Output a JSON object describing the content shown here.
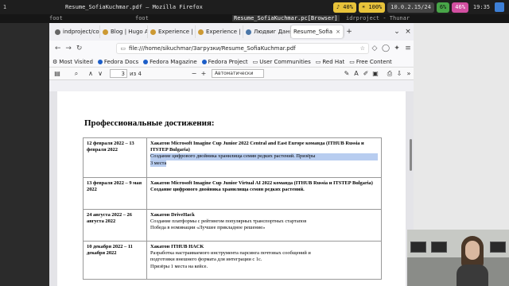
{
  "system_bar": {
    "workspace": "1",
    "window_title": "Resume_SofiaKuchmar.pdf — Mozilla Firefox",
    "volume": "40%",
    "brightness": "100%",
    "network": "10.0.2.15/24",
    "cpu": "6%",
    "battery": "46%",
    "clock": "19:35"
  },
  "taskbar": {
    "left_label": "foot",
    "mid_label": "foot",
    "active_label": "Resume_SofiaKuchmar.pc[Browser]",
    "right_label": "idrproject - Thunar"
  },
  "tabs": [
    {
      "label": "indproject/con",
      "active": false
    },
    {
      "label": "Blog | Hugo Ac",
      "active": false
    },
    {
      "label": "Experience | H",
      "active": false
    },
    {
      "label": "Experience | H",
      "active": false
    },
    {
      "label": "Людвиг Даня",
      "active": false
    },
    {
      "label": "Resume_Sofia",
      "active": true
    }
  ],
  "nav": {
    "url": "file:///home/sikuchmar/Загрузки/Resume_SofiaKuchmar.pdf"
  },
  "bookmarks": [
    "Most Visited",
    "Fedora Docs",
    "Fedora Magazine",
    "Fedora Project",
    "User Communities",
    "Red Hat",
    "Free Content"
  ],
  "pdf_toolbar": {
    "page_number": "3",
    "page_of": "из 4",
    "zoom": "Автоматически"
  },
  "document": {
    "heading": "Профессиональные достижения:",
    "rows": [
      {
        "date": "12 февраля 2022 – 13 февраля 2022",
        "title": "Хакатон Microsoft Imagine Cup Junior 2022 Central and East Europe команда (ITHUB Russia и ITSTEP Bulgaria)",
        "line1": "Создание цифрового двойника хранилища семян редких растений.  Призёры",
        "line2": "3 места",
        "line3": ""
      },
      {
        "date": "13 февраля 2022 – 9 мая 2022",
        "title": "Хакатон Microsoft Imagine Cup Junior Virtual AI 2022 команда (ITHUB Russia и ITSTEP Bulgaria)",
        "line1": "Создание цифрового двойника хранилища семян редких растений.",
        "line2": "",
        "line3": ""
      },
      {
        "date": "24 августа 2022 – 26 августа 2022",
        "title": "Хакатон DriveHack",
        "line1": "Создание платформы с рейтингом популярных транспортных стартапов",
        "line2": "Победа в номинации «Лучшее прикладное решение»",
        "line3": ""
      },
      {
        "date": "10 декабря 2022 – 11 декабря 2022",
        "title": "Хакатон ITHUB HACK",
        "line1": "Разработка настраиваемого инструмента парсинга почтовых сообщений и",
        "line2": "подготовки внешнего формата для интеграции с 1с.",
        "line3": "Призёры 1 места на кейсе."
      }
    ]
  }
}
